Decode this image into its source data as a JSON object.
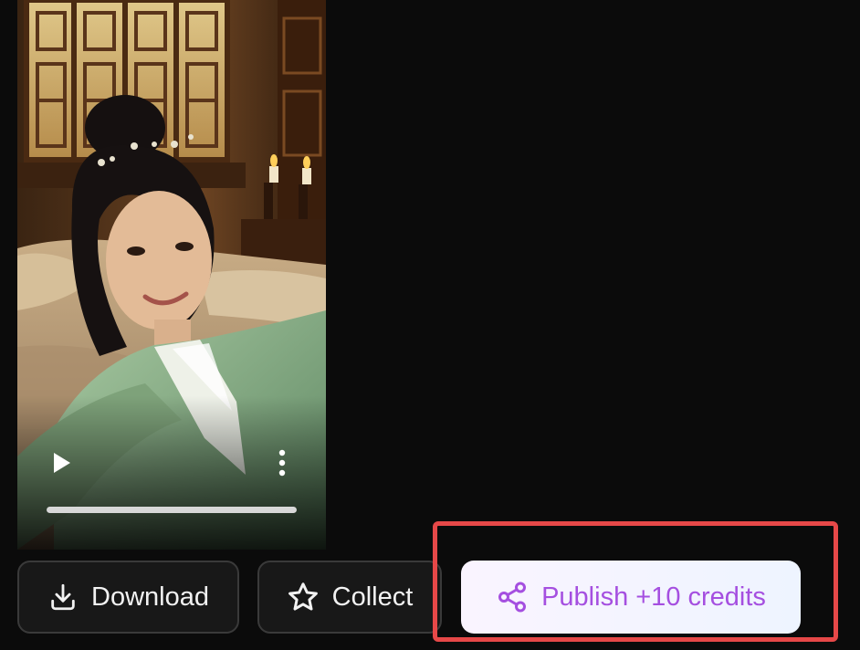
{
  "video": {
    "progress": 1.0
  },
  "actions": {
    "download_label": "Download",
    "collect_label": "Collect",
    "publish_label": "Publish +10 credits"
  },
  "colors": {
    "accent": "#a54fe0",
    "highlight": "#e64848",
    "background": "#0b0b0b"
  },
  "icons": {
    "download": "download-icon",
    "collect": "star-icon",
    "publish": "share-icon",
    "play": "play-icon",
    "more": "more-vertical-icon"
  }
}
